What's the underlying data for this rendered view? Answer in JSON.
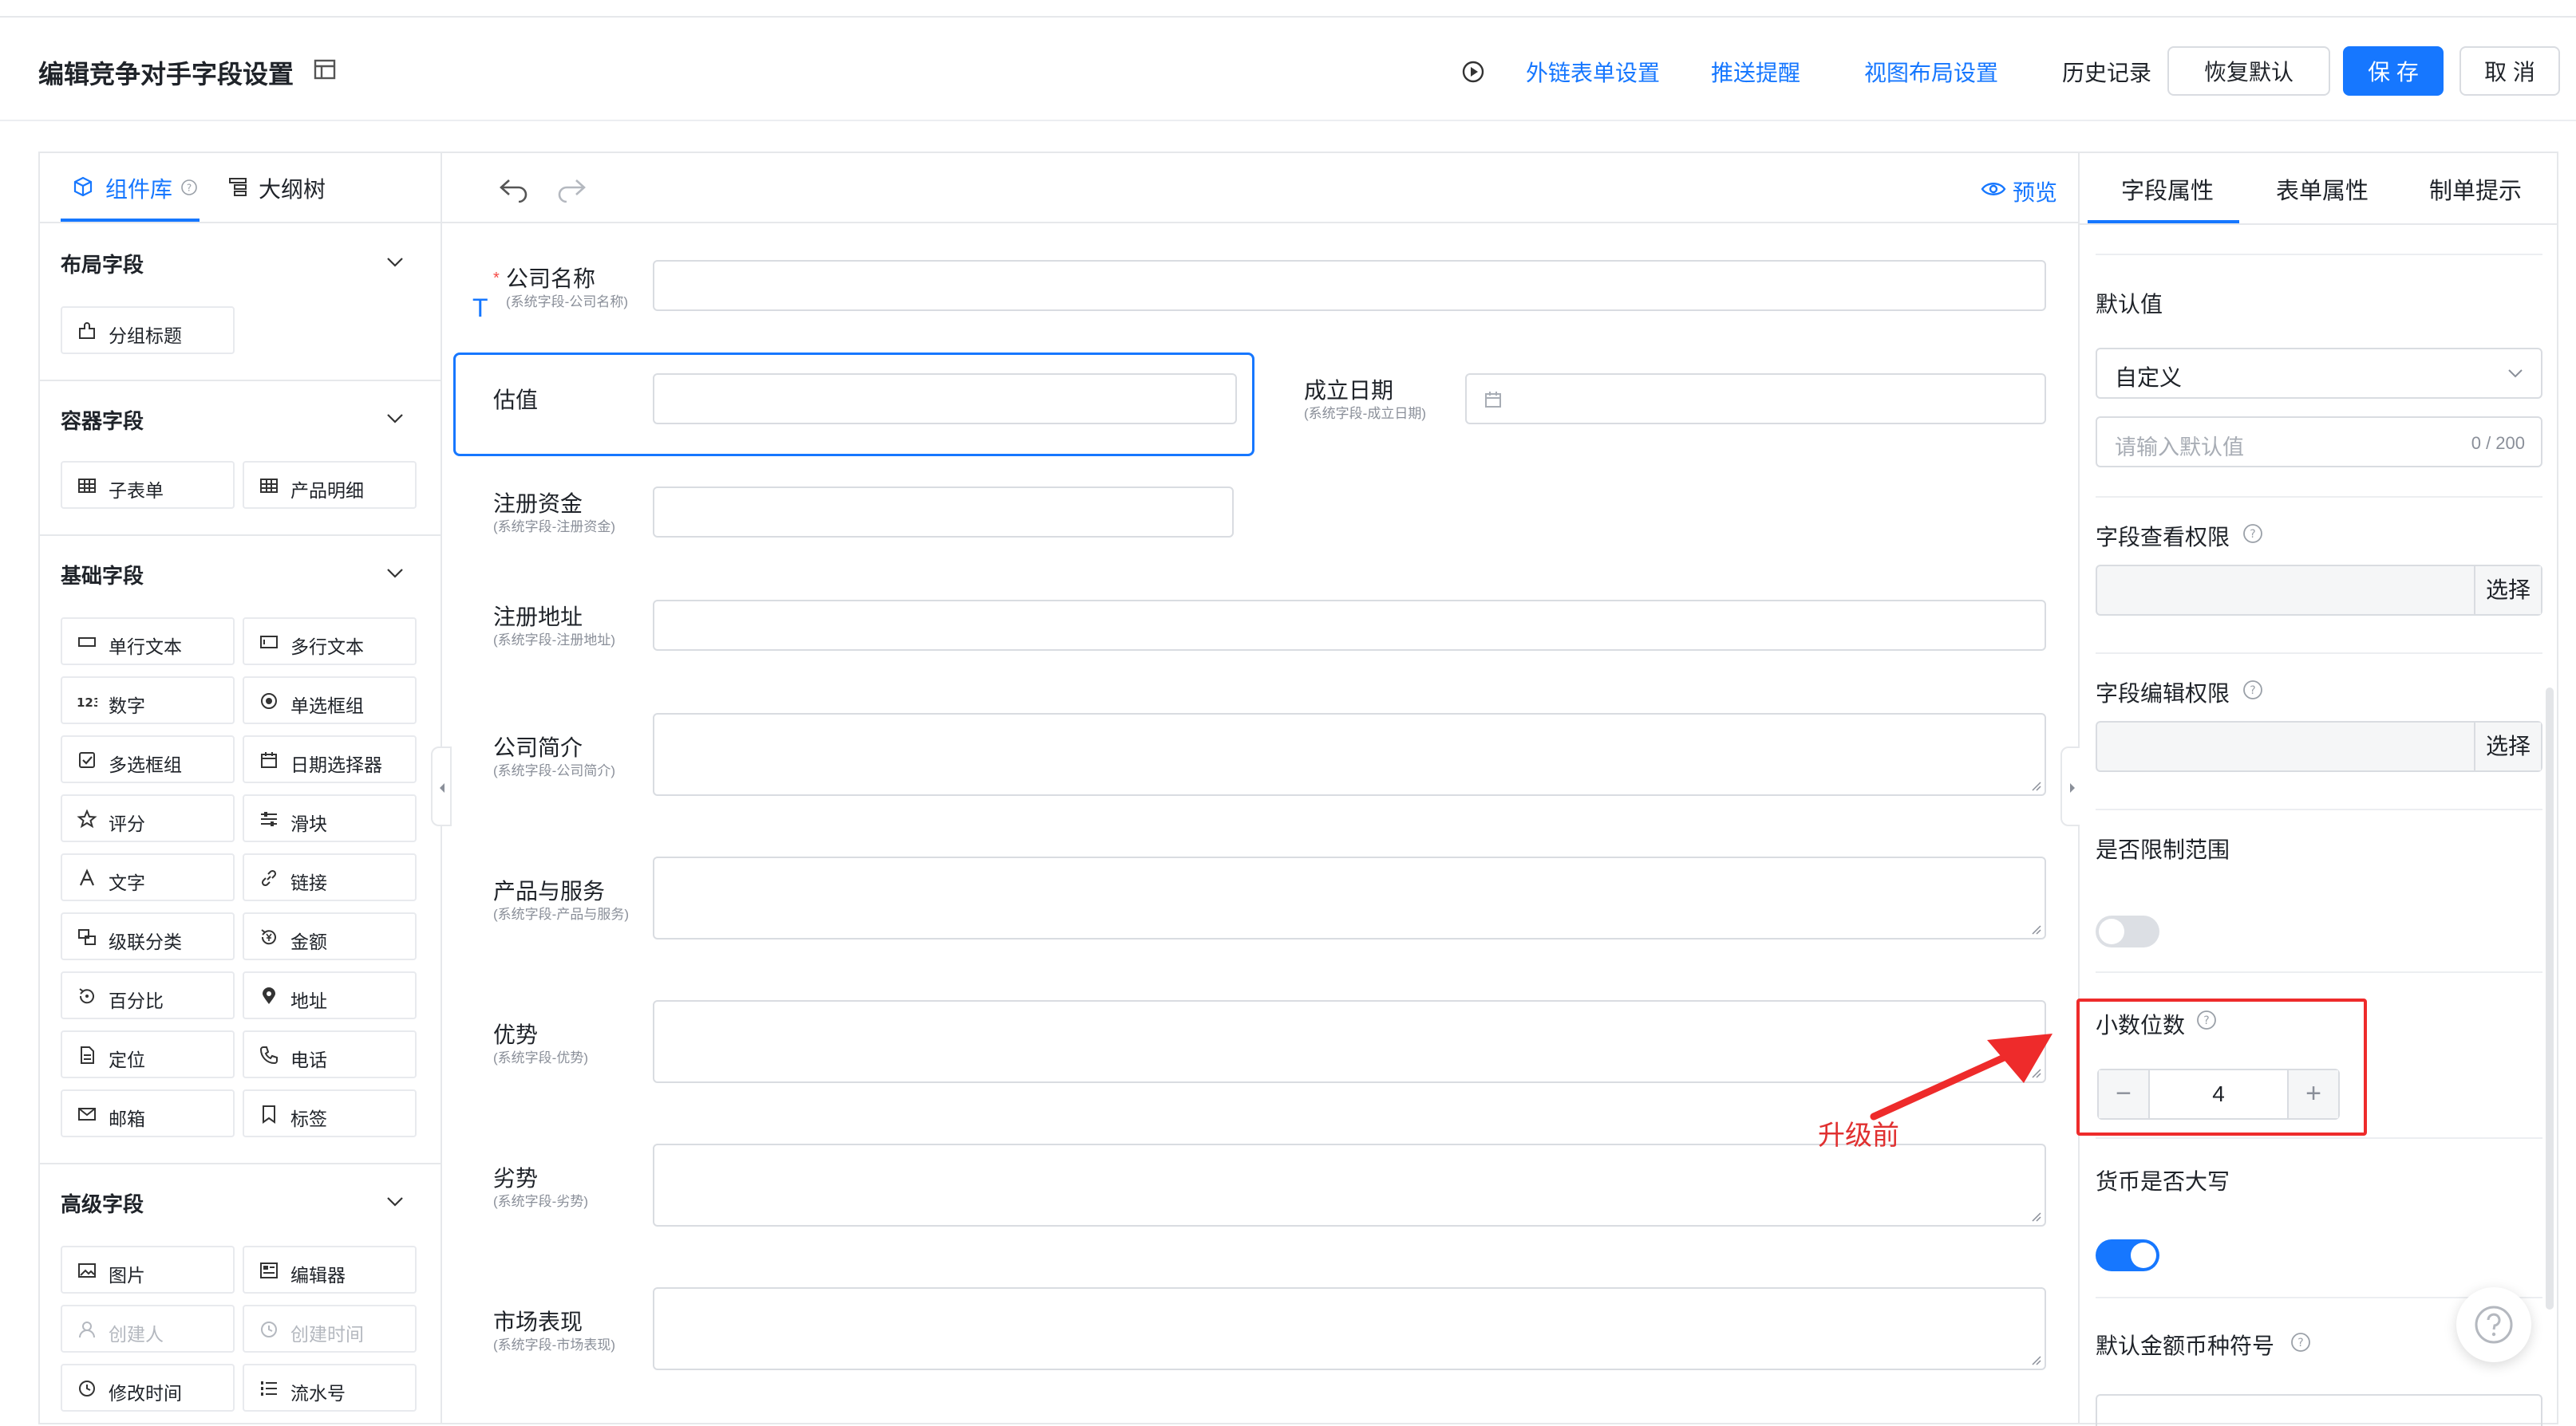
{
  "header": {
    "title": "编辑竞争对手字段设置",
    "links": [
      "外链表单设置",
      "推送提醒",
      "视图布局设置"
    ],
    "history": "历史记录",
    "restore_button": "恢复默认",
    "save_button": "保 存",
    "cancel_button": "取 消"
  },
  "left_panel": {
    "tabs": {
      "components": "组件库",
      "outline": "大纲树"
    },
    "sections": [
      {
        "title": "布局字段",
        "items": [
          "分组标题"
        ]
      },
      {
        "title": "容器字段",
        "items": [
          "子表单",
          "产品明细"
        ]
      },
      {
        "title": "基础字段",
        "items": [
          "单行文本",
          "多行文本",
          "数字",
          "单选框组",
          "多选框组",
          "日期选择器",
          "评分",
          "滑块",
          "文字",
          "链接",
          "级联分类",
          "金额",
          "百分比",
          "地址",
          "定位",
          "电话",
          "邮箱",
          "标签"
        ]
      },
      {
        "title": "高级字段",
        "items": [
          "图片",
          "编辑器",
          "创建人",
          "创建时间",
          "修改时间",
          "流水号"
        ]
      }
    ]
  },
  "canvas": {
    "preview": "预览",
    "fields": [
      {
        "label": "公司名称",
        "sub": "(系统字段-公司名称)"
      },
      {
        "label": "估值",
        "sub": ""
      },
      {
        "label": "成立日期",
        "sub": "(系统字段-成立日期)"
      },
      {
        "label": "注册资金",
        "sub": "(系统字段-注册资金)"
      },
      {
        "label": "注册地址",
        "sub": "(系统字段-注册地址)"
      },
      {
        "label": "公司简介",
        "sub": "(系统字段-公司简介)"
      },
      {
        "label": "产品与服务",
        "sub": "(系统字段-产品与服务)"
      },
      {
        "label": "优势",
        "sub": "(系统字段-优势)"
      },
      {
        "label": "劣势",
        "sub": "(系统字段-劣势)"
      },
      {
        "label": "市场表现",
        "sub": "(系统字段-市场表现)"
      }
    ],
    "annotation": "升级前"
  },
  "right_panel": {
    "tabs": [
      "字段属性",
      "表单属性",
      "制单提示"
    ],
    "default_value_label": "默认值",
    "default_select": "自定义",
    "default_placeholder": "请输入默认值",
    "default_counter": "0 / 200",
    "view_perm_label": "字段查看权限",
    "edit_perm_label": "字段编辑权限",
    "choose": "选择",
    "limit_range_label": "是否限制范围",
    "limit_range_on": false,
    "decimal_label": "小数位数",
    "decimal_value": "4",
    "uppercase_label": "货币是否大写",
    "uppercase_on": true,
    "currency_symbol_label": "默认金额币种符号"
  },
  "colors": {
    "accent": "#1677ff",
    "annotation": "#ee2b2b"
  }
}
